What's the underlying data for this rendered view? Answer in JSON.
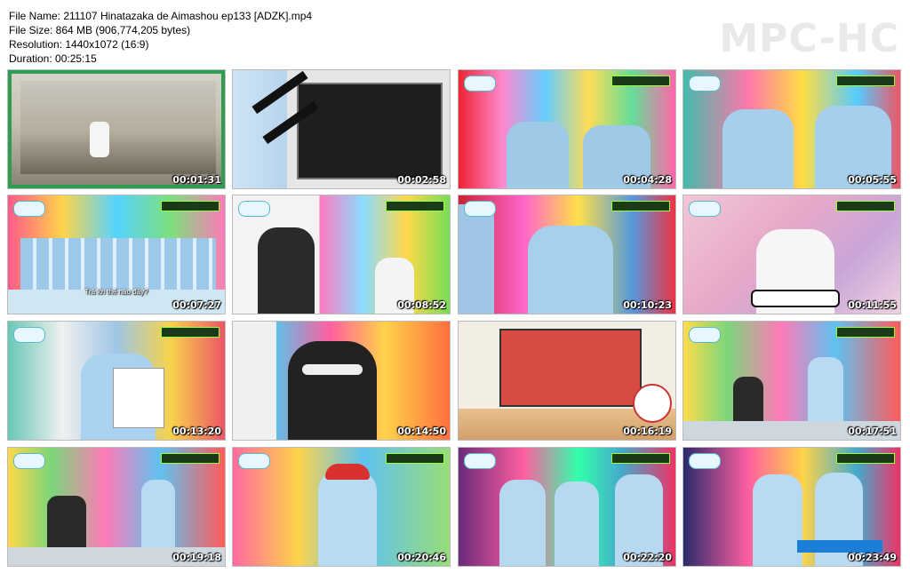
{
  "file_info": {
    "name": "File Name: 211107 Hinatazaka de Aimashou ep133 [ADZK].mp4",
    "size": "File Size: 864 MB (906,774,205 bytes)",
    "resolution": "Resolution: 1440x1072 (16:9)",
    "duration": "Duration: 00:25:15"
  },
  "brand": "MPC-HC",
  "thumbnails": [
    {
      "time": "00:01:31",
      "subtitle": ""
    },
    {
      "time": "00:02:58",
      "subtitle": ""
    },
    {
      "time": "00:04:28",
      "subtitle": ""
    },
    {
      "time": "00:05:55",
      "subtitle": ""
    },
    {
      "time": "00:07:27",
      "subtitle": "Trả lời thế nào đây?"
    },
    {
      "time": "00:08:52",
      "subtitle": ""
    },
    {
      "time": "00:10:23",
      "subtitle": ""
    },
    {
      "time": "00:11:55",
      "subtitle": ""
    },
    {
      "time": "00:13:20",
      "subtitle": ""
    },
    {
      "time": "00:14:50",
      "subtitle": ""
    },
    {
      "time": "00:16:19",
      "subtitle": ""
    },
    {
      "time": "00:17:51",
      "subtitle": ""
    },
    {
      "time": "00:19:18",
      "subtitle": ""
    },
    {
      "time": "00:20:46",
      "subtitle": ""
    },
    {
      "time": "00:22:20",
      "subtitle": ""
    },
    {
      "time": "00:23:49",
      "subtitle": ""
    }
  ]
}
